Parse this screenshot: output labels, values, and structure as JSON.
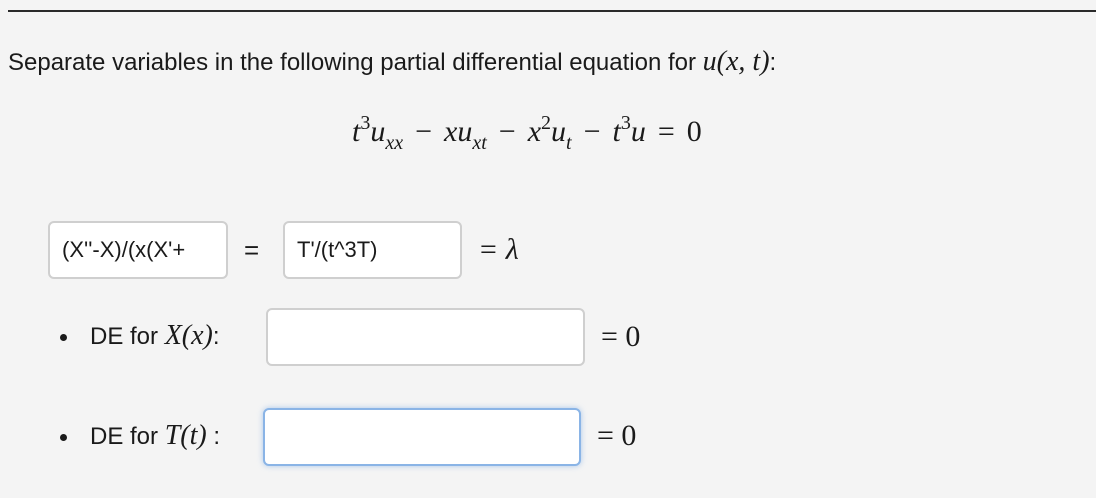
{
  "problem": {
    "prompt_text": "Separate variables in the following partial differential equation for",
    "function_symbol": "u(x, t)",
    "prompt_suffix": ":"
  },
  "equation": {
    "display": "t³u_xx − xu_xt − x²u_t − t³u = 0"
  },
  "separation": {
    "left_input_value": "(X''-X)/(x(X'+",
    "middle_sign": "=",
    "right_input_value": "T'/(t^3T)",
    "equals_lambda": "= λ"
  },
  "de_list": [
    {
      "label_prefix": "DE for",
      "func": "X(x)",
      "label_suffix": ":",
      "value": "",
      "equals_zero": "= 0"
    },
    {
      "label_prefix": "DE for",
      "func": "T(t)",
      "label_suffix": " :",
      "value": "",
      "equals_zero": "= 0"
    }
  ],
  "colors": {
    "background": "#f4f4f4",
    "input_border": "#cfcfcf",
    "focus_border": "#8ab4e6"
  }
}
